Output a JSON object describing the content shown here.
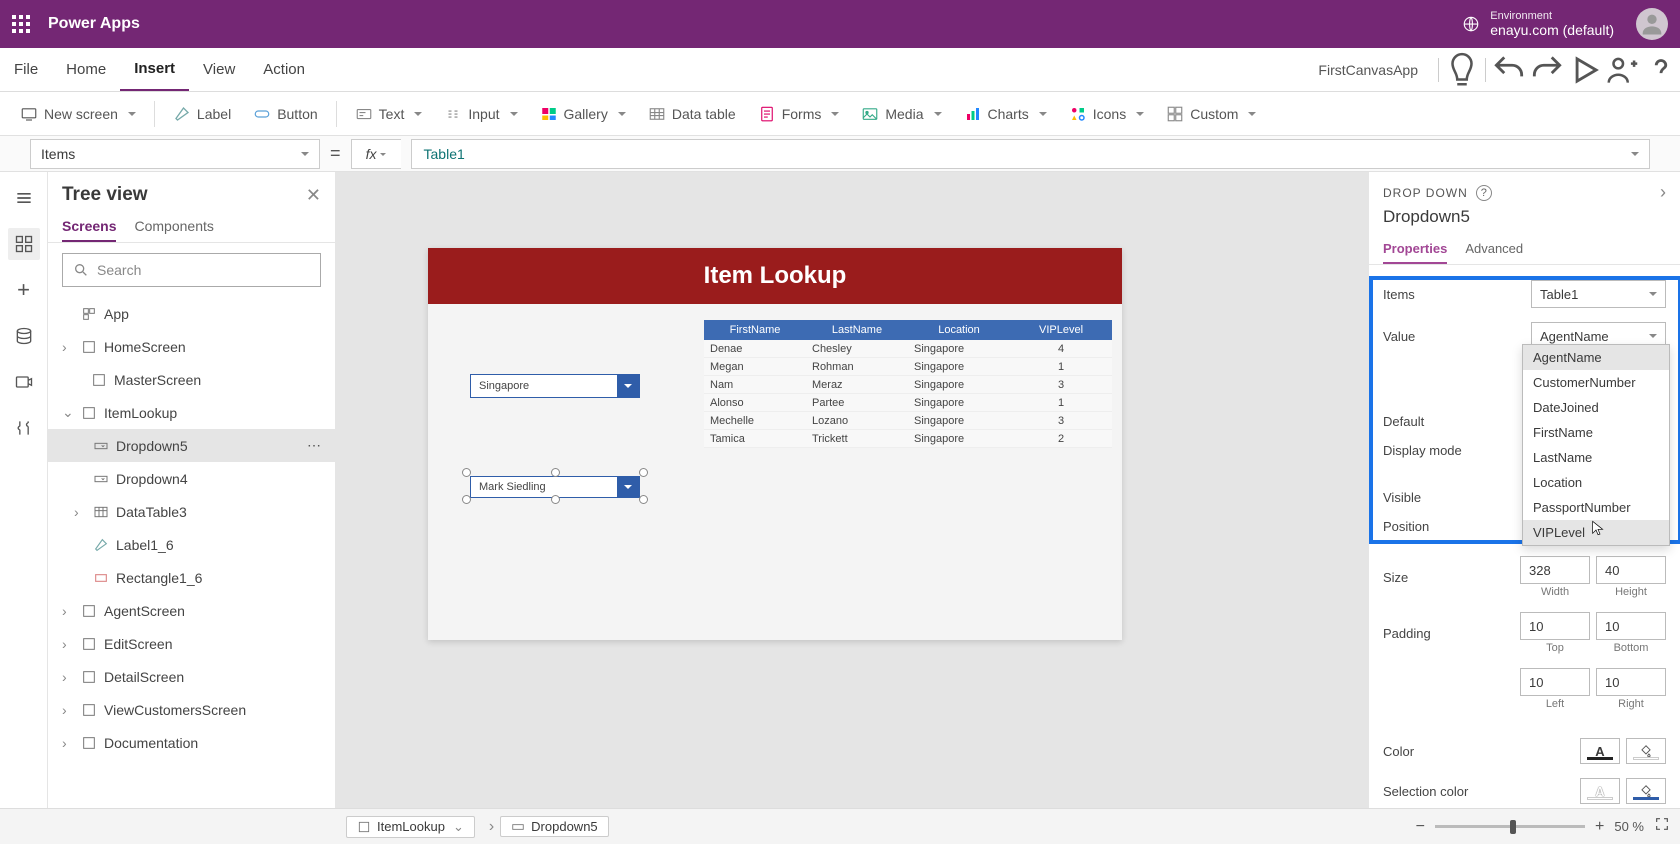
{
  "header": {
    "brand": "Power Apps",
    "env_label": "Environment",
    "env_value": "enayu.com (default)"
  },
  "menubar": {
    "items": [
      "File",
      "Home",
      "Insert",
      "View",
      "Action"
    ],
    "active": "Insert",
    "app_name": "FirstCanvasApp"
  },
  "ribbon": {
    "new_screen": "New screen",
    "label": "Label",
    "button": "Button",
    "text": "Text",
    "input": "Input",
    "gallery": "Gallery",
    "data_table": "Data table",
    "forms": "Forms",
    "media": "Media",
    "charts": "Charts",
    "icons": "Icons",
    "custom": "Custom"
  },
  "formula": {
    "property": "Items",
    "expression": "Table1"
  },
  "tree": {
    "title": "Tree view",
    "tabs": [
      "Screens",
      "Components"
    ],
    "active_tab": "Screens",
    "search_placeholder": "Search",
    "app": "App",
    "screens": [
      {
        "name": "HomeScreen"
      },
      {
        "name": "MasterScreen"
      },
      {
        "name": "ItemLookup",
        "expanded": true,
        "children": [
          {
            "name": "Dropdown5",
            "type": "dropdown",
            "selected": true
          },
          {
            "name": "Dropdown4",
            "type": "dropdown"
          },
          {
            "name": "DataTable3",
            "type": "datatable",
            "expandable": true
          },
          {
            "name": "Label1_6",
            "type": "label"
          },
          {
            "name": "Rectangle1_6",
            "type": "rect"
          }
        ]
      },
      {
        "name": "AgentScreen"
      },
      {
        "name": "EditScreen"
      },
      {
        "name": "DetailScreen"
      },
      {
        "name": "ViewCustomersScreen"
      },
      {
        "name": "Documentation"
      }
    ]
  },
  "canvas": {
    "title": "Item Lookup",
    "dropdown1": "Singapore",
    "dropdown2": "Mark Siedling",
    "table": {
      "columns": [
        "FirstName",
        "LastName",
        "Location",
        "VIPLevel"
      ],
      "rows": [
        [
          "Denae",
          "Chesley",
          "Singapore",
          "4"
        ],
        [
          "Megan",
          "Rohman",
          "Singapore",
          "1"
        ],
        [
          "Nam",
          "Meraz",
          "Singapore",
          "3"
        ],
        [
          "Alonso",
          "Partee",
          "Singapore",
          "1"
        ],
        [
          "Mechelle",
          "Lozano",
          "Singapore",
          "3"
        ],
        [
          "Tamica",
          "Trickett",
          "Singapore",
          "2"
        ]
      ]
    }
  },
  "props": {
    "caption": "DROP DOWN",
    "control_name": "Dropdown5",
    "tabs": [
      "Properties",
      "Advanced"
    ],
    "active_tab": "Properties",
    "rows": {
      "items_label": "Items",
      "items_value": "Table1",
      "value_label": "Value",
      "value_value": "AgentName",
      "default_label": "Default",
      "display_mode_label": "Display mode",
      "visible_label": "Visible",
      "position_label": "Position",
      "size_label": "Size",
      "size_w": "328",
      "size_h": "40",
      "size_w_lbl": "Width",
      "size_h_lbl": "Height",
      "padding_label": "Padding",
      "pad_t": "10",
      "pad_b": "10",
      "pad_l": "10",
      "pad_r": "10",
      "pad_t_lbl": "Top",
      "pad_b_lbl": "Bottom",
      "pad_l_lbl": "Left",
      "pad_r_lbl": "Right",
      "color_label": "Color",
      "sel_color_label": "Selection color"
    },
    "value_options": [
      "AgentName",
      "CustomerNumber",
      "DateJoined",
      "FirstName",
      "LastName",
      "Location",
      "PassportNumber",
      "VIPLevel"
    ],
    "value_highlighted": "VIPLevel"
  },
  "footer": {
    "crumb1": "ItemLookup",
    "crumb2": "Dropdown5",
    "zoom_pct": "50 %"
  }
}
